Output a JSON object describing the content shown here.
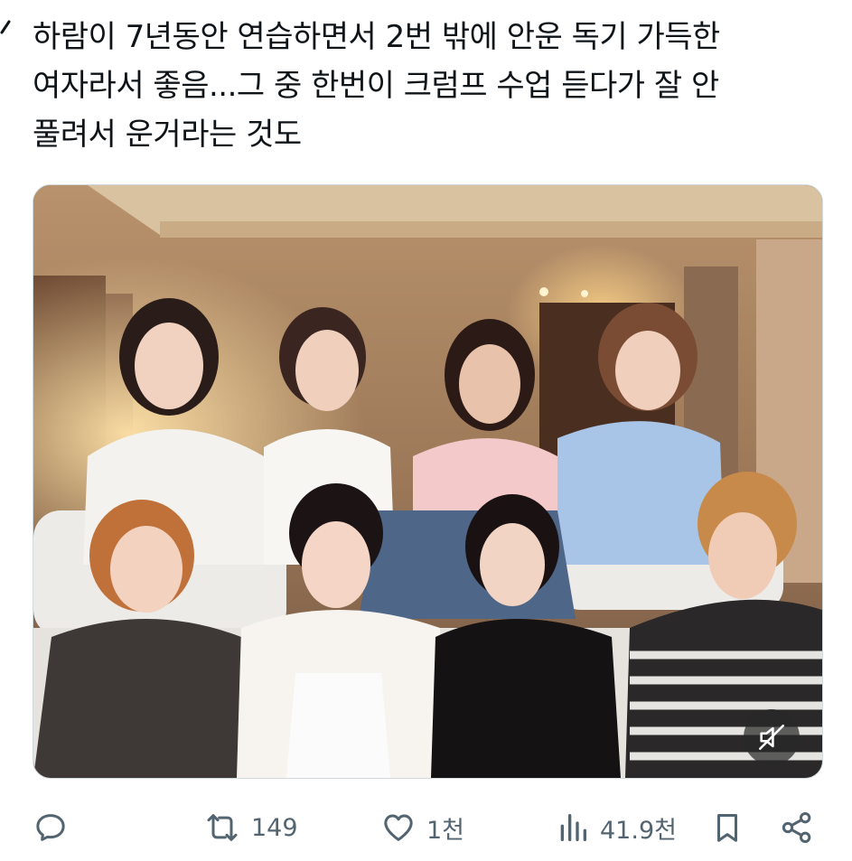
{
  "post": {
    "text_lines": [
      "하람이 7년동안 연습하면서 2번 밖에 안운 독기 가득한",
      "여자라서 좋음...그 중 한번이 크럼프 수업 듣다가 잘 안",
      "풀려서 운거라는 것도"
    ]
  },
  "media": {
    "type": "video",
    "muted": true,
    "mute_icon": "speaker-muted-icon"
  },
  "actions": {
    "reply": {
      "icon": "reply-icon",
      "count": ""
    },
    "repost": {
      "icon": "repost-icon",
      "count": "149"
    },
    "like": {
      "icon": "heart-icon",
      "count": "1천"
    },
    "views": {
      "icon": "views-chart-icon",
      "count": "41.9천"
    },
    "bookmark": {
      "icon": "bookmark-icon"
    },
    "share": {
      "icon": "share-icon"
    }
  },
  "colors": {
    "text": "#0f1419",
    "icon": "#536471",
    "border": "#cfd9de"
  }
}
